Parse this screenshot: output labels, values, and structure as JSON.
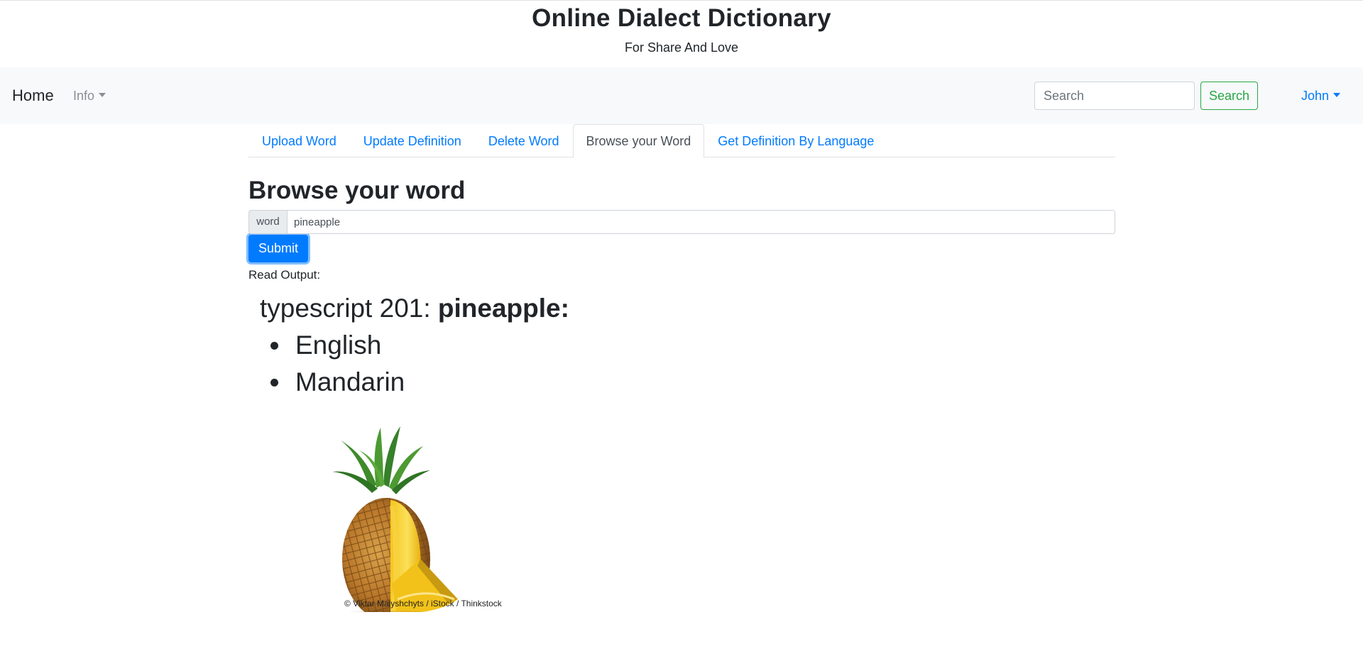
{
  "header": {
    "title": "Online Dialect Dictionary",
    "subtitle": "For Share And Love"
  },
  "navbar": {
    "brand": "Home",
    "info_label": "Info",
    "search_placeholder": "Search",
    "search_button": "Search",
    "user_label": "John",
    "accent_color": "#007bff",
    "search_color": "#28a745"
  },
  "tabs": [
    {
      "label": "Upload Word"
    },
    {
      "label": "Update Definition"
    },
    {
      "label": "Delete Word"
    },
    {
      "label": "Browse your Word",
      "active": true
    },
    {
      "label": "Get Definition By Language"
    }
  ],
  "form": {
    "heading": "Browse your word",
    "prefix": "word",
    "value": "pineapple",
    "submit": "Submit"
  },
  "output": {
    "label": "Read Output:",
    "prefix": "typescript 201:",
    "word": "pineapple:",
    "languages": [
      "English",
      "Mandarin"
    ],
    "image_credit": "©  Viktar Malyshchyts / iStock / Thinkstock"
  }
}
